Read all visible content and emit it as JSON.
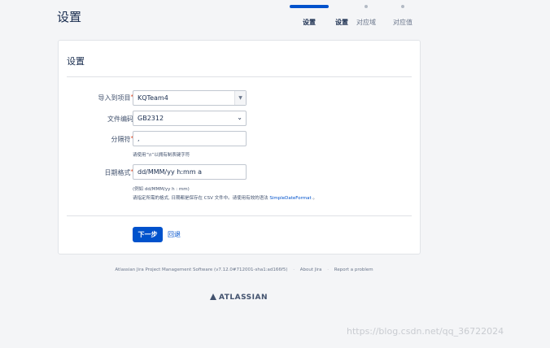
{
  "page": {
    "title": "设置"
  },
  "stepper": {
    "steps": [
      {
        "label": "设置",
        "state": "done"
      },
      {
        "label": "设置",
        "state": "active"
      },
      {
        "label": "对应域",
        "state": "pending"
      },
      {
        "label": "对应值",
        "state": "pending"
      }
    ]
  },
  "card": {
    "title": "设置"
  },
  "form": {
    "project": {
      "label": "导入到项目",
      "required_mark": "*",
      "value": "KQTeam4"
    },
    "encoding": {
      "label": "文件编码",
      "value": "GB2312"
    },
    "delimiter": {
      "label": "分隔符",
      "required_mark": "*",
      "value": ",",
      "hint": "请使用“\\t”以拥有制表键字符"
    },
    "date_format": {
      "label": "日期格式",
      "required_mark": "*",
      "value": "dd/MMM/yy h:mm a",
      "hint1": "(例如 dd/MMM/yy h : mm)",
      "hint2_before": "请指定所需的格式, 日期都是保存在 CSV 文件中。请使用有效的语法",
      "hint2_link": "SimpleDateFormat",
      "hint2_after": "。"
    }
  },
  "actions": {
    "next_label": "下一步",
    "back_label": "回退"
  },
  "footer": {
    "software": "Atlassian Jira Project Management Software (v7.12.0#712001-sha1:ad166f5)",
    "separator": "·",
    "about": "About Jira",
    "report": "Report a problem"
  },
  "logo": {
    "text": "ATLASSIAN"
  },
  "watermark": {
    "text": "https://blog.csdn.net/qq_36722024"
  },
  "colors": {
    "primary": "#0052cc",
    "required": "#de350b",
    "background": "#f4f5f7"
  }
}
